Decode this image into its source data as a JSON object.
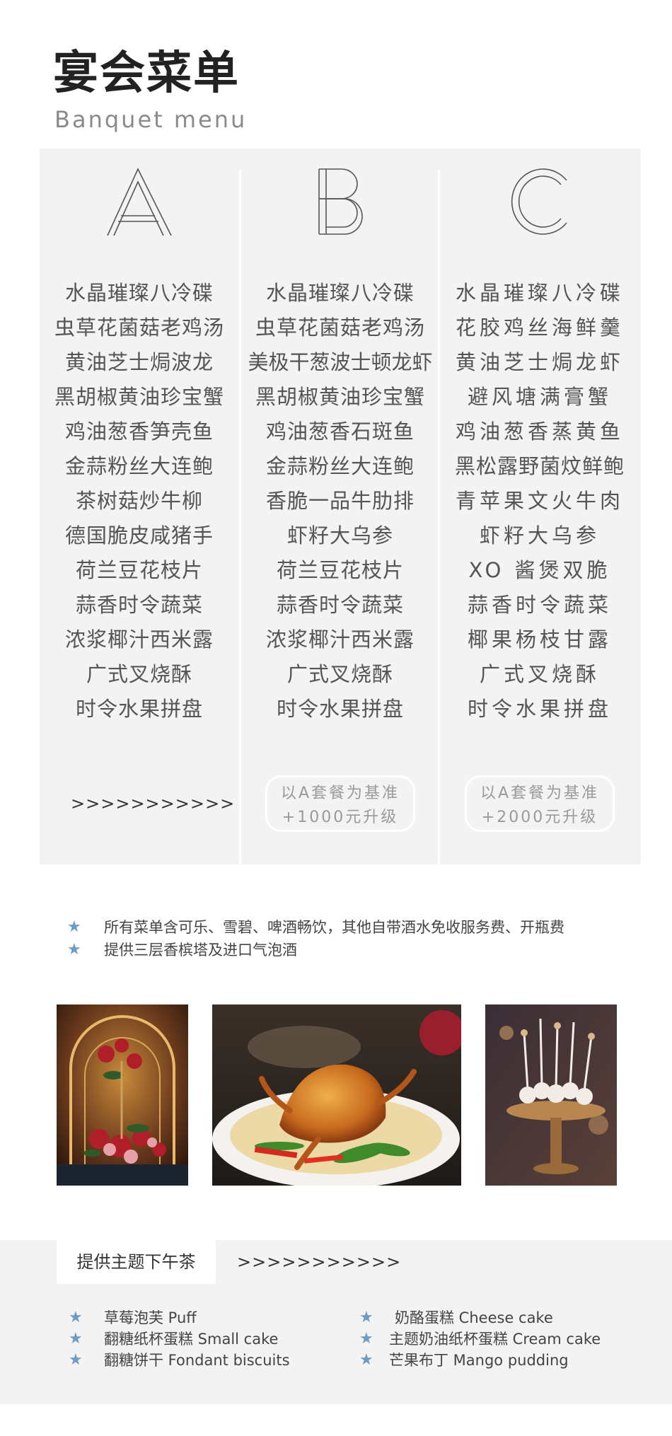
{
  "header": {
    "title": "宴会菜单",
    "subtitle": "Banquet  menu"
  },
  "menus": [
    {
      "letter": "A",
      "dishes": [
        "水晶璀璨八冷碟",
        "虫草花菌菇老鸡汤",
        "黄油芝士焗波龙",
        "黑胡椒黄油珍宝蟹",
        "鸡油葱香笋壳鱼",
        "金蒜粉丝大连鲍",
        "茶树菇炒牛柳",
        "德国脆皮咸猪手",
        "荷兰豆花枝片",
        "蒜香时令蔬菜",
        "浓浆椰汁西米露",
        "广式叉烧酥",
        "时令水果拼盘"
      ],
      "footer": ">>>>>>>>>>>"
    },
    {
      "letter": "B",
      "dishes": [
        "水晶璀璨八冷碟",
        "虫草花菌菇老鸡汤",
        "美极干葱波士顿龙虾",
        "黑胡椒黄油珍宝蟹",
        "鸡油葱香石斑鱼",
        "金蒜粉丝大连鲍",
        "香脆一品牛肋排",
        "虾籽大乌参",
        "荷兰豆花枝片",
        "蒜香时令蔬菜",
        "浓浆椰汁西米露",
        "广式叉烧酥",
        "时令水果拼盘"
      ],
      "upgrade": [
        "以A套餐为基准",
        "+1000元升级"
      ]
    },
    {
      "letter": "C",
      "dishes": [
        "水晶璀璨八冷碟",
        "花胶鸡丝海鲜羹",
        "黄油芝士焗龙虾",
        "避风塘满膏蟹",
        "鸡油葱香蒸黄鱼",
        "黑松露野菌炆鲜鲍",
        "青苹果文火牛肉",
        "虾籽大乌参",
        "XO 酱煲双脆",
        "蒜香时令蔬菜",
        "椰果杨枝甘露",
        "广式叉烧酥",
        "时令水果拼盘"
      ],
      "upgrade": [
        "以A套餐为基准",
        "+2000元升级"
      ]
    }
  ],
  "notes": [
    "所有菜单含可乐、雪碧、啤酒畅饮，其他自带酒水免收服务费、开瓶费",
    "提供三层香槟塔及进口气泡酒"
  ],
  "photos": [
    "floral-arrangement",
    "crab-dish",
    "cake-pops"
  ],
  "tea": {
    "tag": "提供主题下午茶",
    "arrows": ">>>>>>>>>>>",
    "left": [
      "草莓泡芙 Puff",
      "翻糖纸杯蛋糕 Small  cake",
      "翻糖饼干 Fondant  biscuits"
    ],
    "right": [
      "奶酪蛋糕 Cheese  cake",
      "主题奶油纸杯蛋糕 Cream  cake",
      "芒果布丁 Mango  pudding"
    ]
  },
  "colors": {
    "star": "#6d9bc3",
    "panel": "#f3f3f3",
    "title": "#222222"
  }
}
